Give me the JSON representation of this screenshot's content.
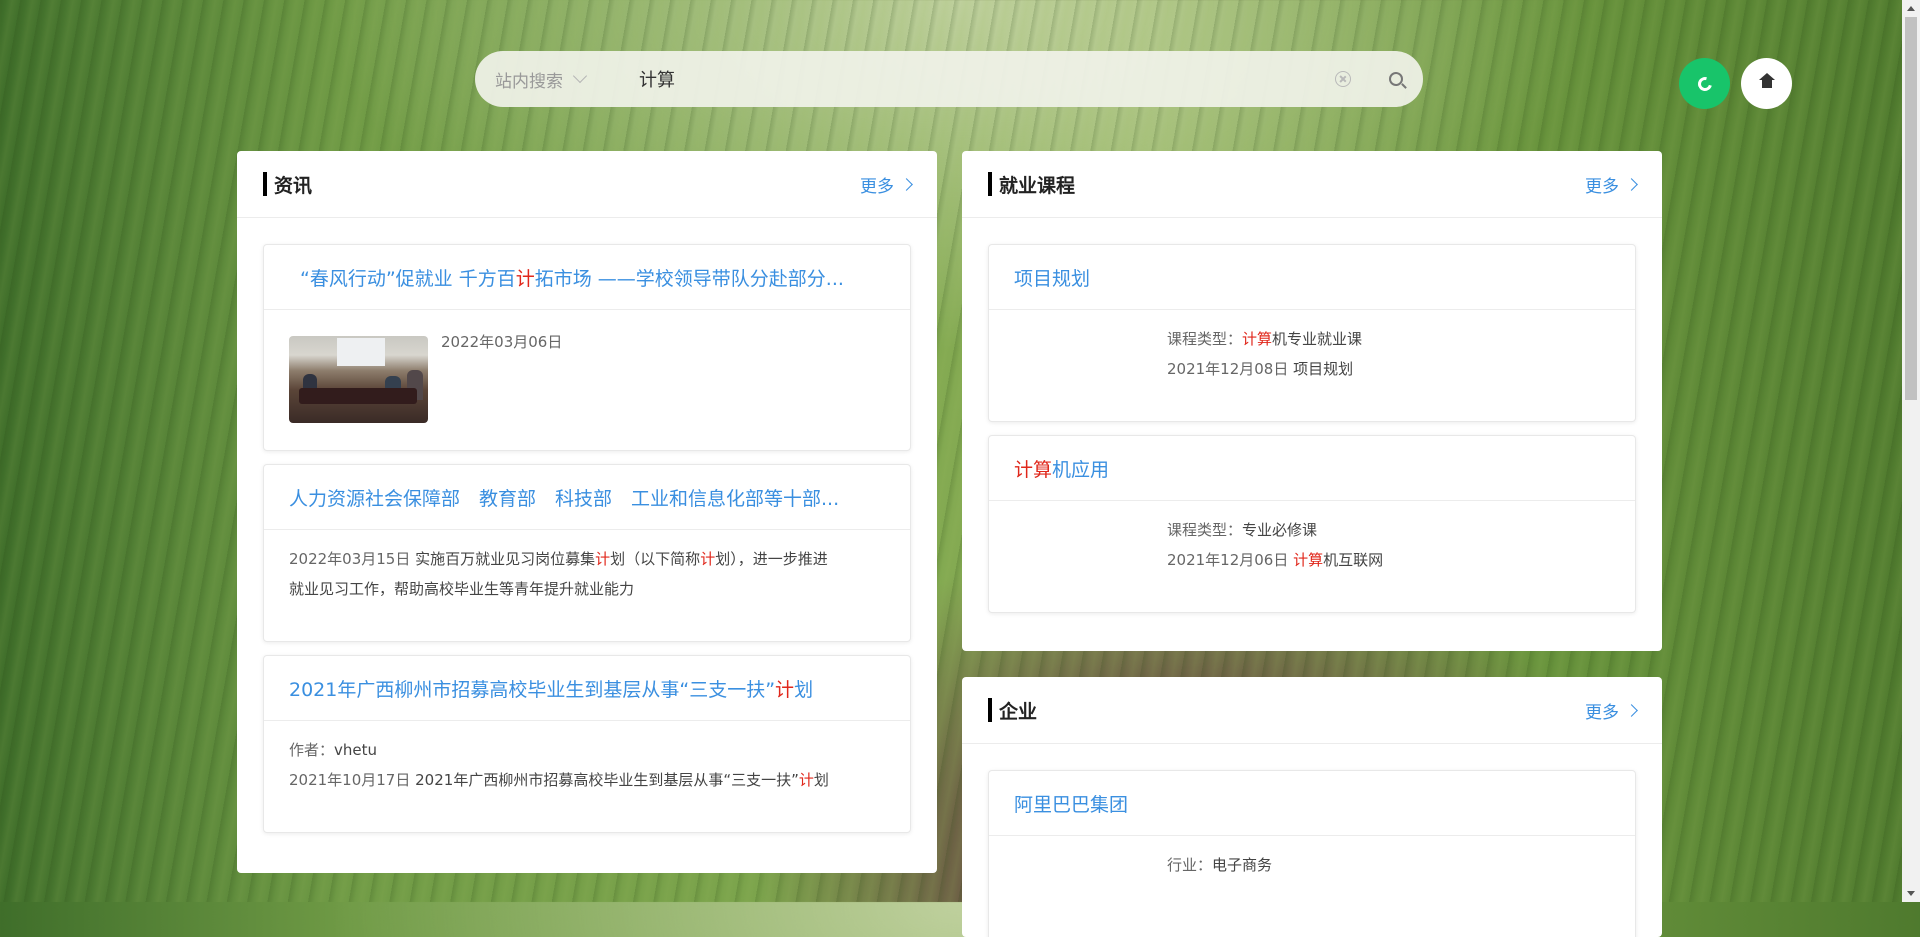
{
  "search": {
    "scope": "站内搜索",
    "query": "计算"
  },
  "news": {
    "title": "资讯",
    "more": "更多",
    "items": [
      {
        "title_pre": "“春风行动”促就业 千方百",
        "title_hl": "计",
        "title_post": "拓市场 ——学校领导带队分赴部分...",
        "date": "2022年03月06日"
      },
      {
        "title": "人力资源社会保障部　教育部　科技部　工业和信息化部等十部...",
        "date": "2022年03月15日",
        "text_a": "实施百万就业见习岗位募集",
        "text_hl1": "计",
        "text_b": "划（以下简称",
        "text_hl2": "计",
        "text_c": "划），进一步推进",
        "text_line2": "就业见习工作，帮助高校毕业生等青年提升就业能力"
      },
      {
        "title_pre": "2021年广西柳州市招募高校毕业生到基层从事“三支一扶”",
        "title_hl": "计",
        "title_post": "划",
        "author_label": "作者：",
        "author": "vhetu",
        "date": "2021年10月17日",
        "text_pre": "2021年广西柳州市招募高校毕业生到基层从事“三支一扶”",
        "text_hl": "计",
        "text_post": "划"
      }
    ]
  },
  "courses": {
    "title": "就业课程",
    "more": "更多",
    "items": [
      {
        "title": "项目规划",
        "type_label": "课程类型：",
        "type_hl": "计算",
        "type_rest": "机专业就业课",
        "date": "2021年12月08日",
        "desc": "项目规划"
      },
      {
        "title_hl": "计算",
        "title_rest": "机应用",
        "type_label": "课程类型：",
        "type_value": "专业必修课",
        "date": "2021年12月06日",
        "desc_hl": "计算",
        "desc_rest": "机互联网"
      }
    ]
  },
  "companies": {
    "title": "企业",
    "more": "更多",
    "items": [
      {
        "title": "阿里巴巴集团",
        "industry_label": "行业：",
        "industry": "电子商务"
      }
    ]
  }
}
